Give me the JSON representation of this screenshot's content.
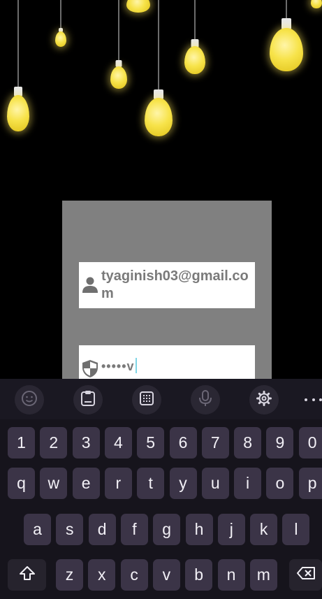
{
  "login": {
    "email_value": "tyaginish03@gmail.com",
    "password_value": "•••••v"
  },
  "keyboard": {
    "toolbar": [
      {
        "name": "emoji-icon"
      },
      {
        "name": "clipboard-icon"
      },
      {
        "name": "keypad-icon"
      },
      {
        "name": "microphone-icon"
      },
      {
        "name": "gear-icon"
      },
      {
        "name": "more-icon"
      }
    ],
    "number_row": [
      "1",
      "2",
      "3",
      "4",
      "5",
      "6",
      "7",
      "8",
      "9",
      "0"
    ],
    "row1": [
      "q",
      "w",
      "e",
      "r",
      "t",
      "y",
      "u",
      "i",
      "o",
      "p"
    ],
    "row2": [
      "a",
      "s",
      "d",
      "f",
      "g",
      "h",
      "j",
      "k",
      "l"
    ],
    "row3": [
      "z",
      "x",
      "c",
      "v",
      "b",
      "n",
      "m"
    ],
    "shift_icon": "shift-icon",
    "backspace_icon": "backspace-icon"
  },
  "colors": {
    "card_gray": "#808080",
    "key_bg": "#3b3447",
    "keyboard_bg": "#16141c",
    "bulb_yellow": "#f7e34a"
  }
}
